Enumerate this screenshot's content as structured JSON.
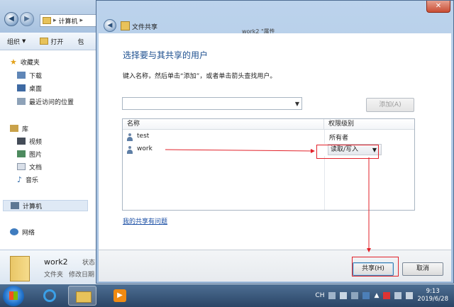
{
  "explorer": {
    "breadcrumb": [
      "计算机"
    ],
    "toolbar": {
      "organize": "组织",
      "open": "打开",
      "more": "包"
    },
    "nav": {
      "favorites": "收藏夹",
      "favorites_items": [
        "下载",
        "桌面",
        "最近访问的位置"
      ],
      "libraries": "库",
      "libraries_items": [
        "视频",
        "图片",
        "文档",
        "音乐"
      ],
      "computer": "计算机",
      "network": "网络"
    },
    "details": {
      "name": "work2",
      "status_label": "状态",
      "type": "文件夹",
      "modified": "修改日期"
    }
  },
  "dialog": {
    "caption": "文件共享",
    "bg_tab_fragment": "work2 \"属性",
    "heading": "选择要与其共享的用户",
    "instruction": "键入名称，然后单击“添加”，或者单击箭头查找用户。",
    "name_input": {
      "value": "",
      "placeholder": ""
    },
    "add_button": "添加(A)",
    "columns": {
      "name": "名称",
      "permission": "权限级别"
    },
    "rows": [
      {
        "name": "test",
        "permission": "所有者"
      },
      {
        "name": "work",
        "permission": "读取/写入"
      }
    ],
    "help_link": "我的共享有问题",
    "share_button": "共享(H)",
    "cancel_button": "取消"
  },
  "taskbar": {
    "language": "CH",
    "time": "9:13",
    "date": "2019/6/28"
  },
  "colors": {
    "annotation_red": "#e2222a",
    "link_blue": "#1b4fa5",
    "heading_blue": "#1c4f8f"
  }
}
